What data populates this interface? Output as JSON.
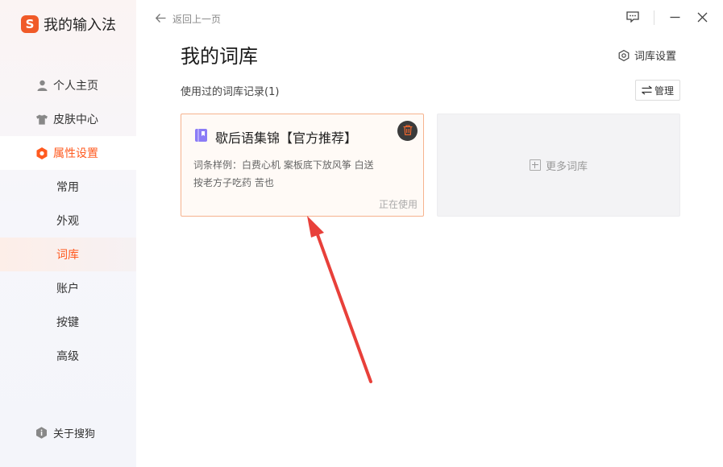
{
  "app": {
    "name": "我的输入法",
    "logo_letter": "S",
    "accent_color": "#ff5a1f"
  },
  "topbar": {
    "back_label": "返回上一页"
  },
  "sidebar": {
    "items": [
      {
        "label": "个人主页",
        "icon": "person-icon"
      },
      {
        "label": "皮肤中心",
        "icon": "tshirt-icon"
      },
      {
        "label": "属性设置",
        "icon": "hexagon-settings-icon",
        "active": true
      }
    ],
    "sub_items": [
      {
        "label": "常用"
      },
      {
        "label": "外观"
      },
      {
        "label": "词库",
        "active": true
      },
      {
        "label": "账户"
      },
      {
        "label": "按键"
      },
      {
        "label": "高级"
      }
    ],
    "about_label": "关于搜狗"
  },
  "main": {
    "title": "我的词库",
    "lib_settings_label": "词库设置",
    "record_title": "使用过的词库记录(1)",
    "manage_label": "管理",
    "card": {
      "title": "歇后语集锦【官方推荐】",
      "sample": "词条样例：白费心机  案板底下放风筝  白送  按老方子吃药  苦也",
      "status": "正在使用"
    },
    "more_label": "更多词库"
  }
}
